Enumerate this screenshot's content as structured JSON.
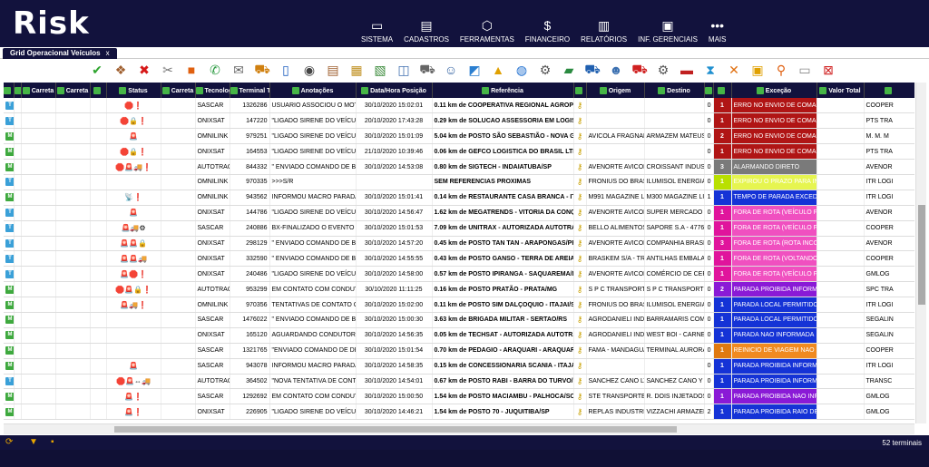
{
  "app": {
    "logo": "Risk"
  },
  "nav": [
    {
      "label": "SISTEMA",
      "icon": "monitor-icon",
      "glyph": "▭"
    },
    {
      "label": "CADASTROS",
      "icon": "registry-icon",
      "glyph": "▤"
    },
    {
      "label": "FERRAMENTAS",
      "icon": "cube-icon",
      "glyph": "⬡"
    },
    {
      "label": "FINANCEIRO",
      "icon": "money-icon",
      "glyph": "$"
    },
    {
      "label": "RELATÓRIOS",
      "icon": "bar-chart-icon",
      "glyph": "▥"
    },
    {
      "label": "INF. GERENCIAIS",
      "icon": "dashboard-icon",
      "glyph": "▣"
    },
    {
      "label": "MAIS",
      "icon": "more-dots-icon",
      "glyph": "•••"
    }
  ],
  "tab": {
    "label": "Grid Operacional Veículos",
    "close": "x"
  },
  "columns": [
    "",
    "V",
    "Carreta",
    "Carreta",
    "",
    "Status",
    "Carreta",
    "Tecnolog",
    "Terminal T",
    "Anotações",
    "Data/Hora Posição",
    "Referência",
    "",
    "Origem",
    "Destino",
    "",
    "",
    "Exceção",
    "Valor Total",
    ""
  ],
  "rows": [
    {
      "type": "T",
      "st": "🛑❗",
      "tec": "SASCAR",
      "term": "1326286",
      "an": "USUARIO ASSOCIOU O MOTORISTA",
      "dt": "30/10/2020 15:02:01",
      "ref": "0.11 km de COOPERATIVA REGIONAL AGROPECUARIA",
      "orig": "",
      "dest": "",
      "n": "0",
      "lvl": "1",
      "lc": "#b01515",
      "exc": "ERRO NO ENVIO DE COMANDO",
      "ec": "#b01515",
      "val": "",
      "last": "COOPER"
    },
    {
      "type": "T",
      "st": "🛑🔒❗",
      "tec": "ONIXSAT",
      "term": "147220",
      "an": "\"LIGADO SIRENE DO VEÍCULO",
      "dt": "20/10/2020 17:43:28",
      "ref": "0.29 km de SOLUCAO ASSESSORIA EM LOGISTICA",
      "orig": "",
      "dest": "",
      "n": "0",
      "lvl": "1",
      "lc": "#b01515",
      "exc": "ERRO NO ENVIO DE COMANDO",
      "ec": "#b01515",
      "val": "",
      "last": "PTS TRA"
    },
    {
      "type": "M",
      "st": "🚨",
      "tec": "OMNILINK",
      "term": "979251",
      "an": "\"LIGADO SIRENE DO VEÍCULO",
      "dt": "30/10/2020 15:01:09",
      "ref": "5.04 km de POSTO SÃO SEBASTIÃO - NOVA GLORIA",
      "orig": "AVICOLA FRAGNANI",
      "dest": "ARMAZEM MATEUS S",
      "n": "0",
      "lvl": "2",
      "lc": "#b01515",
      "exc": "ERRO NO ENVIO DE COMANDO",
      "ec": "#b01515",
      "val": "",
      "last": "M. M. M"
    },
    {
      "type": "M",
      "st": "🛑🔒❗",
      "tec": "ONIXSAT",
      "term": "164553",
      "an": "\"LIGADO SIRENE DO VEÍCULO",
      "dt": "21/10/2020 10:39:46",
      "ref": "0.06 km de GEFCO LOGISTICA DO BRASIL LTDA",
      "orig": "",
      "dest": "",
      "n": "0",
      "lvl": "1",
      "lc": "#b01515",
      "exc": "ERRO NO ENVIO DE COMANDO",
      "ec": "#b01515",
      "val": "",
      "last": "PTS TRA"
    },
    {
      "type": "M",
      "st": "🛑🚨🚚❗",
      "tec": "AUTOTRAC",
      "term": "844332",
      "an": "\" ENVIADO COMANDO DE BLOQUEIO",
      "dt": "30/10/2020 14:53:08",
      "ref": "0.80 km de SIGTECH - INDAIATUBA/SP",
      "orig": "AVENORTE AVICOLA C",
      "dest": "CROISSANT INDUSTRIA",
      "n": "0",
      "lvl": "3",
      "lc": "#7a7a7a",
      "exc": "ALARMANDO DIRETO",
      "ec": "#7a7a7a",
      "val": "",
      "last": "AVENOR"
    },
    {
      "type": "T",
      "st": "",
      "tec": "OMNILINK",
      "term": "970335",
      "an": ">>>S/R",
      "dt": "",
      "ref": "SEM REFERENCIAS PROXIMAS",
      "orig": "FRONIUS DO BRASIL",
      "dest": "ILUMISOL ENERGIA S",
      "n": "0",
      "lvl": "1",
      "lc": "#b9e000",
      "exc": "EXPIROU O PRAZO PARA INICIO",
      "ec": "#e6f550",
      "val": "",
      "last": "ITR LOGI"
    },
    {
      "type": "M",
      "st": "📡❗",
      "tec": "OMNILINK",
      "term": "943562",
      "an": "INFORMOU MACRO PARADA P",
      "dt": "30/10/2020 15:01:41",
      "ref": "0.14 km de RESTAURANTE CASA BRANCA - ITAGUAI",
      "orig": "M991 MAGAZINE LUIZ",
      "dest": "M300 MAGAZINE LUIZ",
      "n": "1",
      "lvl": "1",
      "lc": "#1533d6",
      "exc": "TEMPO DE PARADA EXCEDIDO",
      "ec": "#1533d6",
      "val": "",
      "last": "ITR LOGI"
    },
    {
      "type": "T",
      "st": "🚨",
      "tec": "ONIXSAT",
      "term": "144786",
      "an": "\"LIGADO SIRENE DO VEÍCULO",
      "dt": "30/10/2020 14:56:47",
      "ref": "1.62 km de MEGATRENDS - VITORIA DA CONQUISTA",
      "orig": "AVENORTE AVICOLA C",
      "dest": "SUPER MERCADO DO",
      "n": "0",
      "lvl": "1",
      "lc": "#e0149c",
      "exc": "FORA DE ROTA (VEÍCULO FORA)",
      "ec": "#f050c0",
      "val": "",
      "last": "AVENOR"
    },
    {
      "type": "T",
      "st": "🚨🚚⚙",
      "tec": "SASCAR",
      "term": "240886",
      "an": "BX-FINALIZADO O EVENTO DE",
      "dt": "30/10/2020 15:01:53",
      "ref": "7.09 km de UNITRAX - AUTORIZADA AUTOTRAC",
      "orig": "BELLO ALIMENTOS LT",
      "dest": "SAPORE S.A - 477652",
      "n": "0",
      "lvl": "1",
      "lc": "#e0149c",
      "exc": "FORA DE ROTA (VEÍCULO FORA)",
      "ec": "#f050c0",
      "val": "",
      "last": "COOPER"
    },
    {
      "type": "T",
      "st": "🚨🚨🔒",
      "tec": "ONIXSAT",
      "term": "298129",
      "an": "\" ENVIADO COMANDO DE BLOQUEIO",
      "dt": "30/10/2020 14:57:20",
      "ref": "0.45 km de POSTO TAN TAN - ARAPONGAS/PR",
      "orig": "AVENORTE AVICOLA C",
      "dest": "COMPANHIA BRASILEIRA",
      "n": "0",
      "lvl": "3",
      "lc": "#e0149c",
      "exc": "FORA DE ROTA (ROTA INCORRETA)",
      "ec": "#f050c0",
      "val": "",
      "last": "AVENOR"
    },
    {
      "type": "T",
      "st": "🚨🚨🚚",
      "tec": "ONIXSAT",
      "term": "332590",
      "an": "\" ENVIADO COMANDO DE BLOQUEIO",
      "dt": "30/10/2020 14:55:55",
      "ref": "0.43 km de POSTO GANSO - TERRA DE AREIA/RS",
      "orig": "BRASKEM S/A - TRIUN",
      "dest": "ANTILHAS EMBALAGENS",
      "n": "0",
      "lvl": "1",
      "lc": "#e0149c",
      "exc": "FORA DE ROTA (VOLTANDO PARA)",
      "ec": "#f050c0",
      "val": "",
      "last": "COOPER"
    },
    {
      "type": "T",
      "st": "🚨🛑❗",
      "tec": "ONIXSAT",
      "term": "240486",
      "an": "\"LIGADO SIRENE DO VEÍCULO",
      "dt": "30/10/2020 14:58:00",
      "ref": "0.57 km de POSTO IPIRANGA - SAQUAREMA/RJ",
      "orig": "AVENORTE AVICOLA C",
      "dest": "COMÉRCIO DE CEREAIS",
      "n": "0",
      "lvl": "1",
      "lc": "#e0149c",
      "exc": "FORA DE ROTA (VEÍCULO FORA)",
      "ec": "#f050c0",
      "val": "",
      "last": "GMLOG"
    },
    {
      "type": "M",
      "st": "🛑🚨🔒❗",
      "tec": "AUTOTRAC",
      "term": "953299",
      "an": "EM CONTATO COM CONDUTOR",
      "dt": "30/10/2020 11:11:25",
      "ref": "0.16 km de POSTO PRATÃO - PRATA/MG",
      "orig": "S P C TRANSPORTE LT",
      "dest": "S P C TRANSPORTE LT",
      "n": "0",
      "lvl": "2",
      "lc": "#8a1ad6",
      "exc": "PARADA PROIBIDA INFORMADA",
      "ec": "#8a1ad6",
      "val": "",
      "last": "SPC TRA"
    },
    {
      "type": "M",
      "st": "🚨🚚❗",
      "tec": "OMNILINK",
      "term": "970356",
      "an": "TENTATIVAS DE CONTATO COM",
      "dt": "30/10/2020 15:02:00",
      "ref": "0.11 km de POSTO SIM DALÇOQUIO - ITAJAI/SC",
      "orig": "FRONIUS DO BRASIL L",
      "dest": "ILUMISOL ENERGIA SC",
      "n": "0",
      "lvl": "1",
      "lc": "#1533d6",
      "exc": "PARADA LOCAL PERMITIDO NAO",
      "ec": "#1533d6",
      "val": "",
      "last": "ITR LOGI"
    },
    {
      "type": "M",
      "st": "",
      "tec": "SASCAR",
      "term": "1476022",
      "an": "\" ENVIADO COMANDO DE BLOQUEIO",
      "dt": "30/10/2020 15:00:30",
      "ref": "3.63 km de BRIGADA MILITAR - SERTAO/RS",
      "orig": "AGRODANIELI INDUST",
      "dest": "BARRAMARIS COMERC",
      "n": "0",
      "lvl": "1",
      "lc": "#1533d6",
      "exc": "PARADA LOCAL PERMITIDO NAO",
      "ec": "#1533d6",
      "val": "",
      "last": "SEGALIN"
    },
    {
      "type": "M",
      "st": "",
      "tec": "ONIXSAT",
      "term": "165120",
      "an": "AGUARDANDO CONDUTOR",
      "dt": "30/10/2020 14:56:35",
      "ref": "0.05 km de TECHSAT - AUTORIZADA AUTOTRAC",
      "orig": "AGRODANIELI INDUST",
      "dest": "WEST BOI - CARNES E",
      "n": "0",
      "lvl": "1",
      "lc": "#1533d6",
      "exc": "PARADA NAO INFORMADA",
      "ec": "#1533d6",
      "val": "",
      "last": "SEGALIN"
    },
    {
      "type": "M",
      "st": "",
      "tec": "SASCAR",
      "term": "1321765",
      "an": "\"ENVIADO COMANDO DE DESBLOQ",
      "dt": "30/10/2020 15:01:54",
      "ref": "0.70 km de PEDAGIO - ARAQUARI - ARAQUARI/SC",
      "orig": "FAMA - MANDAGUARI",
      "dest": "TERMINAL AURORA IT",
      "n": "0",
      "lvl": "1",
      "lc": "#e07a10",
      "exc": "REINICIO DE VIAGEM NAO INFORMADO",
      "ec": "#f08a20",
      "val": "",
      "last": "COOPER"
    },
    {
      "type": "M",
      "st": "🚨",
      "tec": "SASCAR",
      "term": "943078",
      "an": "INFORMOU MACRO PARADA P",
      "dt": "30/10/2020 14:58:35",
      "ref": "0.15 km de CONCESSIONARIA SCANIA - ITAJAI/SC",
      "orig": "",
      "dest": "",
      "n": "0",
      "lvl": "1",
      "lc": "#1533d6",
      "exc": "PARADA PROIBIDA INFORMADA",
      "ec": "#1533d6",
      "val": "",
      "last": "ITR LOGI"
    },
    {
      "type": "T",
      "st": "🛑🚨⇔🚚",
      "tec": "AUTOTRAC",
      "term": "364502",
      "an": "\"NOVA TENTATIVA DE CONTATO",
      "dt": "30/10/2020 14:54:01",
      "ref": "0.67 km de POSTO RABI - BARRA DO TURVO/SP",
      "orig": "SANCHEZ CANO LTDA",
      "dest": "SANCHEZ CANO Y CC",
      "n": "0",
      "lvl": "1",
      "lc": "#1533d6",
      "exc": "PARADA PROIBIDA INFORMADA",
      "ec": "#1533d6",
      "val": "",
      "last": "TRANSC"
    },
    {
      "type": "M",
      "st": "🚨❗",
      "tec": "SASCAR",
      "term": "1292692",
      "an": "EM CONTATO COM CONDUTOR",
      "dt": "30/10/2020 15:00:50",
      "ref": "1.54 km de POSTO MACIAMBU - PALHOCA/SC",
      "orig": "STE TRANSPORTES S/A",
      "dest": "R. DOIS INJETADOS LT",
      "n": "0",
      "lvl": "1",
      "lc": "#8a1ad6",
      "exc": "PARADA PROIBIDA NAO INFORMADA",
      "ec": "#8a1ad6",
      "val": "",
      "last": "GMLOG"
    },
    {
      "type": "M",
      "st": "🚨❗",
      "tec": "ONIXSAT",
      "term": "226905",
      "an": "\"LIGADO SIRENE DO VEÍCULO",
      "dt": "30/10/2020 14:46:21",
      "ref": "1.54 km de POSTO 70 - JUQUITIBA/SP",
      "orig": "REPLAS INDUSTRIA E",
      "dest": "VIZZACHI ARMAZENA",
      "n": "2",
      "lvl": "1",
      "lc": "#1533d6",
      "exc": "PARADA PROIBIDA RAIO DE OPERACAO",
      "ec": "#1533d6",
      "val": "",
      "last": "GMLOG"
    }
  ],
  "status": {
    "count": "52 terminais"
  }
}
